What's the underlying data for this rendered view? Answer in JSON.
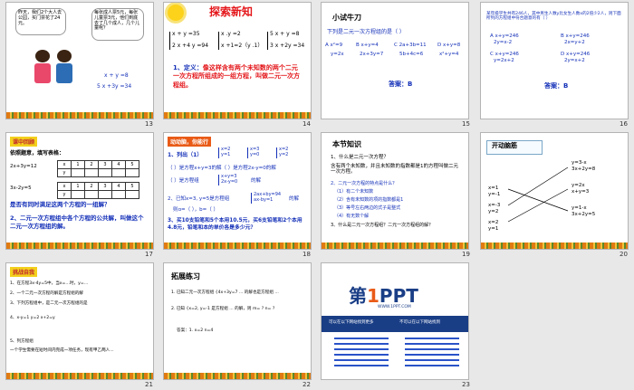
{
  "slides": [
    {
      "number": "13",
      "bubble_left": "昨天，我们2个大人去公园，买门票花了24元。",
      "bubble_right": "每张成人票5元，每张儿童票3元，他们到底去了几个成人，几个儿童呢？",
      "eq1": "x + y =8",
      "eq2": "5 x +3y =34"
    },
    {
      "number": "14",
      "title": "探索新知",
      "sys_a": [
        "x + y =35",
        "2 x +4 y =94"
      ],
      "sys_b": [
        "x .y =2",
        "x +1=2（y .1）"
      ],
      "sys_c": [
        "5 x + y =8",
        "3 x +2y =34"
      ],
      "definition_lead": "1、定义：",
      "definition_body": "像这样含有两个未知数的两个二元一次方程所组成的一组方程，叫做二元一次方程组。"
    },
    {
      "number": "15",
      "heading": "小试牛刀",
      "question": "下列是二元一次方程组的是（    ）",
      "options": [
        "A x²=9",
        "B x+y=4",
        "C 2a+3b=11",
        "D x+y=8",
        "y=2x",
        "2x+3y=7",
        "5b+4c=6",
        "x²+y=4"
      ],
      "answer": "答案：B"
    },
    {
      "number": "16",
      "question": "某年级学生共有246人，其中男生人数y比女生人数x的2倍少2人，则下面所列的方程组中符合题意的有（    ）",
      "options": [
        "A x+y=246",
        "2y=x-2",
        "B x+y=246",
        "2x=y+2",
        "C x+y=246",
        "y=2x+2",
        "D x+y=246",
        "2y=x+2"
      ],
      "answer": "答案：B"
    },
    {
      "number": "17",
      "header": "课中回顾",
      "instruction": "依照题意，填写表格：",
      "row1_label": "2x+3y=12",
      "row2_label": "3x-2y=5",
      "cols": [
        "x",
        "1",
        "2",
        "3",
        "4",
        "5"
      ],
      "question": "是否有同时满足这两个方程的一组解？",
      "def2": "2、二元一次方程组中各个方程的公共解，叫做这个二元一次方程组的解。"
    },
    {
      "number": "18",
      "header": "动动脑，你能行",
      "items": [
        "1、列出（1）",
        "（    ）是方程x+y=3的解（    ）是方程2x-y=0的解",
        "（    ）是方程组",
        "2、已知x=3, y=5是方程组",
        "则ɑ=（    ），b=（    ）",
        "3、买10支铅笔和5个本用10.5元，买6支铅笔和2个本用4.8元，铅笔和本的单价各是多少元？"
      ],
      "sys": [
        "x=2",
        "y=1",
        "x=3",
        "y=0",
        "x=2",
        "y=2"
      ],
      "sys2": [
        "x+y=3",
        "2x-y=0"
      ],
      "sys3": [
        "2ax+by=94",
        "ax-by=1"
      ],
      "tail": "的解"
    },
    {
      "number": "19",
      "heading": "本节知识",
      "lines": [
        "1、什么是二元一次方程？",
        "含有两个未知数，并且未知数的指数都是1的方程叫做二元一次方程。",
        "2、二元一次方程的特点是什么？",
        "（1）有二个未知数",
        "（2）含有未知数的项的指数都是1",
        "（3）等号左右两边的式子是整式",
        "（4）有无数个解",
        "3、什么是二元一次方程组？二元一次方程组的解？"
      ]
    },
    {
      "number": "20",
      "heading": "开动脑筋",
      "left": [
        "x=1",
        "y=-1",
        "x=-3",
        "y=2",
        "x=2",
        "y=1"
      ],
      "right": [
        "y=3-x",
        "3x+2y=8",
        "y=2x",
        "x+y=3",
        "y=1-x",
        "3x+2y=5"
      ]
    },
    {
      "number": "21",
      "header": "挑战自我",
      "lines": [
        "1、在方程3x-4y=5中，当x=…时，y=…",
        "2、一个二元一次方程的解是方程组的解",
        "3、下列方程组中，是二元一次方程组的是",
        "4、x-y=1  y=2 x+2=y",
        "5、列方程组",
        "一个学生需要在短时间内完成一项任务，现有甲乙两人..."
      ]
    },
    {
      "number": "22",
      "heading": "拓展练习",
      "lines": [
        "1. 已知二元一次方程组 {4x+3y=7 ... 的解也是方程组 ...",
        "2. 已知 {x=2, y=-1 是方程组 ... 的解，则 m= ? n= ?",
        "答案：1. x=2   n=4"
      ]
    },
    {
      "number": "23",
      "logo_prefix": "第",
      "logo_num": "1",
      "logo_suffix": "PPT",
      "logo_sub": "WWW.1PPT.COM",
      "box_left": "可以在以下网站找到更多",
      "box_right": "不可以在以下网站找到"
    }
  ],
  "colors": {
    "slide_bg": "#ffffff",
    "background": "#e8e8e8",
    "accent_red": "#e4161a",
    "accent_blue": "#1430b8",
    "logo_blue": "#1a3e86",
    "flower_orange": "#e07a12"
  }
}
